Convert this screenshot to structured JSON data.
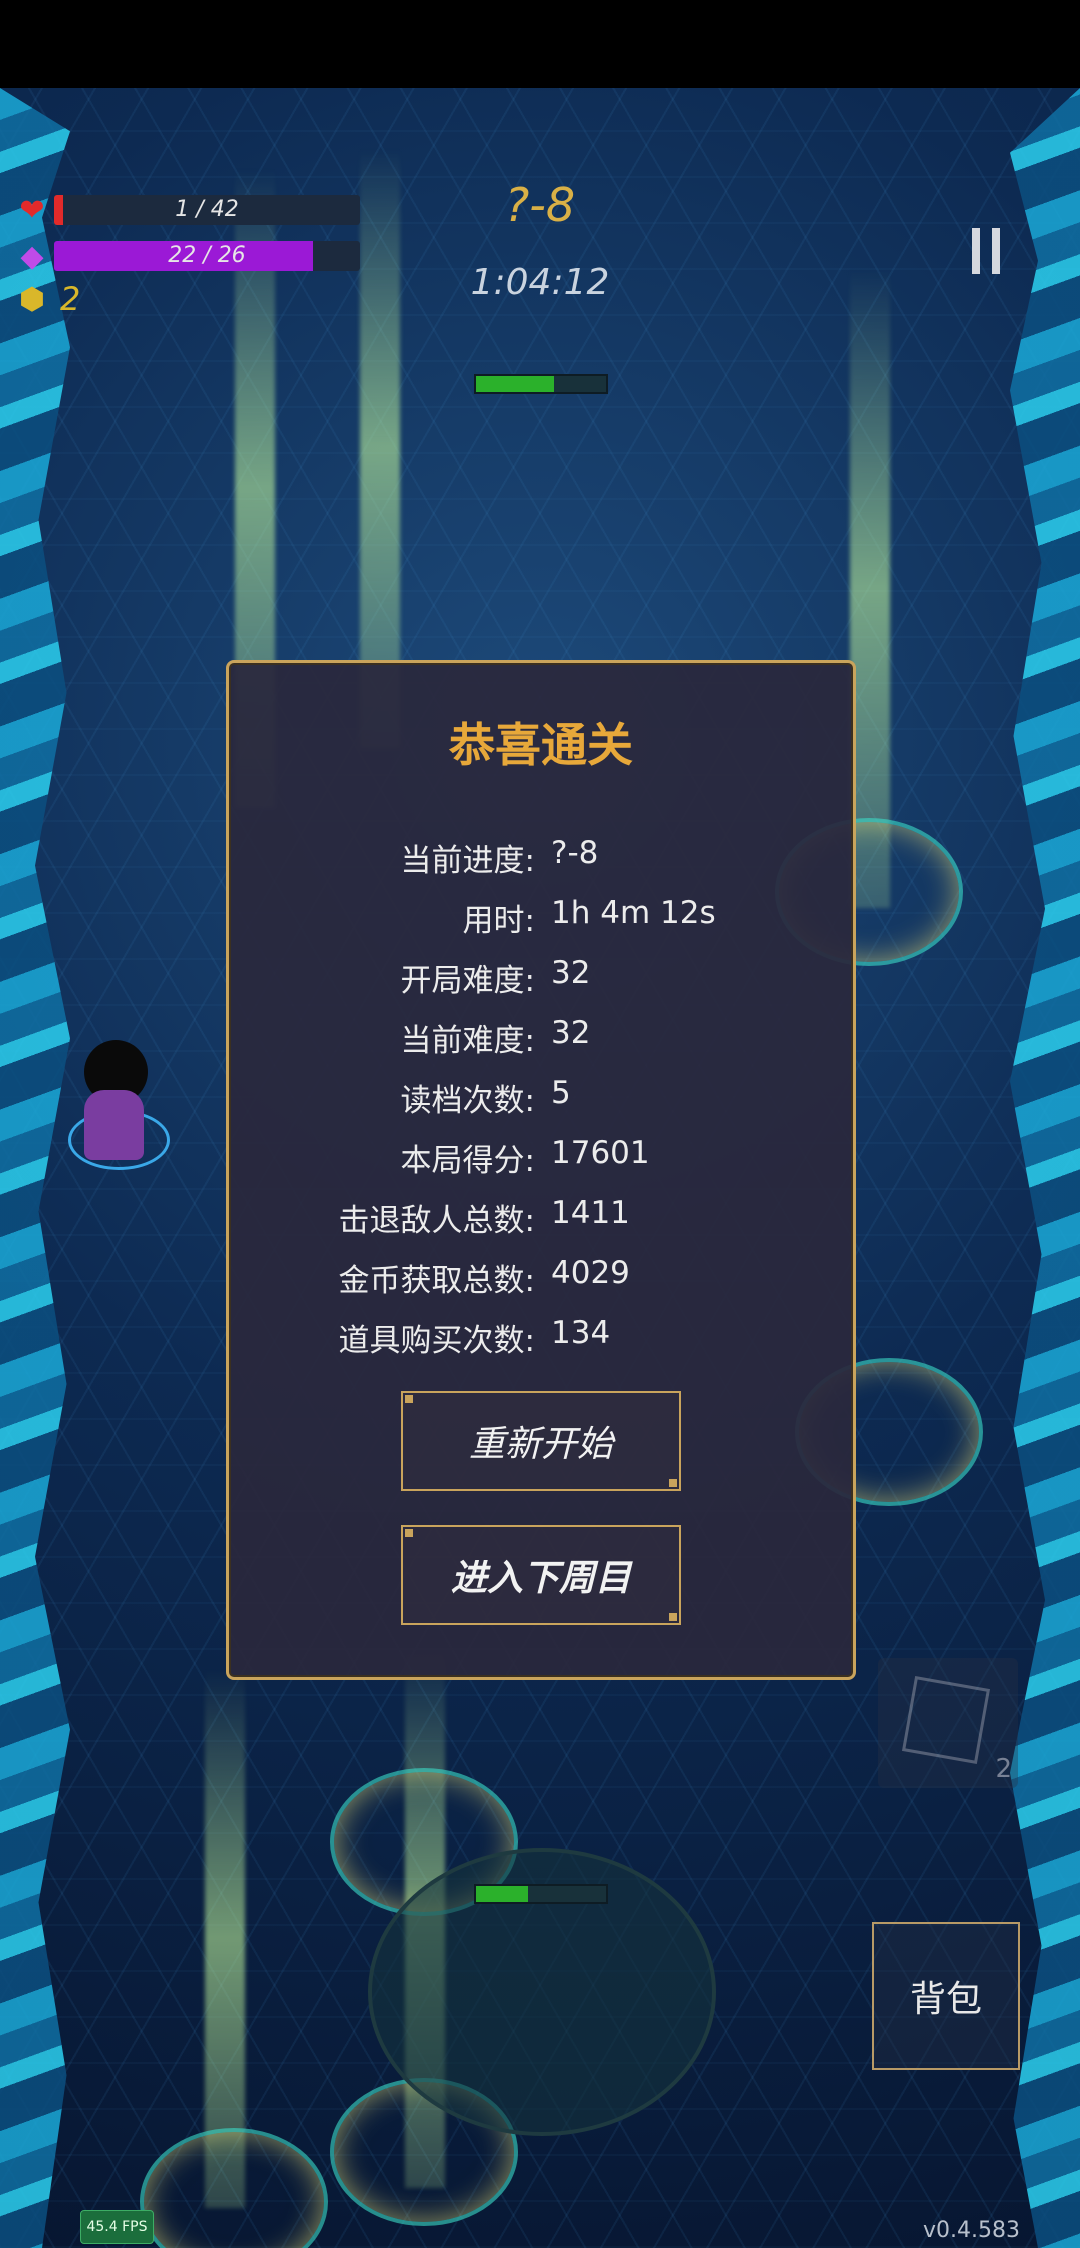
{
  "hud": {
    "hp_text": "1 / 42",
    "hp_fraction": 0.024,
    "mp_text": "22 / 26",
    "mp_fraction": 0.846,
    "coins": "2",
    "level": "?-8",
    "timer": "1:04:12",
    "colors": {
      "hp": "#e22a2a",
      "mp": "#9b19d6",
      "coins": "#d9b72a"
    },
    "icons": [
      "heart-icon",
      "mana-diamond-icon",
      "coin-icon",
      "pause-icon"
    ]
  },
  "dialog": {
    "title": "恭喜通关",
    "stats": [
      {
        "label": "当前进度:",
        "value": "?-8"
      },
      {
        "label": "用时:",
        "value": "1h 4m 12s"
      },
      {
        "label": "开局难度:",
        "value": "32"
      },
      {
        "label": "当前难度:",
        "value": "32"
      },
      {
        "label": "读档次数:",
        "value": "5"
      },
      {
        "label": "本局得分:",
        "value": "17601"
      },
      {
        "label": "击退敌人总数:",
        "value": "1411"
      },
      {
        "label": "金币获取总数:",
        "value": "4029"
      },
      {
        "label": "道具购买次数:",
        "value": "134"
      }
    ],
    "restart_label": "重新开始",
    "next_cycle_label": "进入下周目"
  },
  "enemy_hp": [
    {
      "fraction": 0.6
    },
    {
      "fraction": 0.4
    }
  ],
  "inventory": {
    "bag_label": "背包",
    "item_count": "2"
  },
  "debug": {
    "fps": "45.4 FPS",
    "version": "v0.4.583"
  }
}
